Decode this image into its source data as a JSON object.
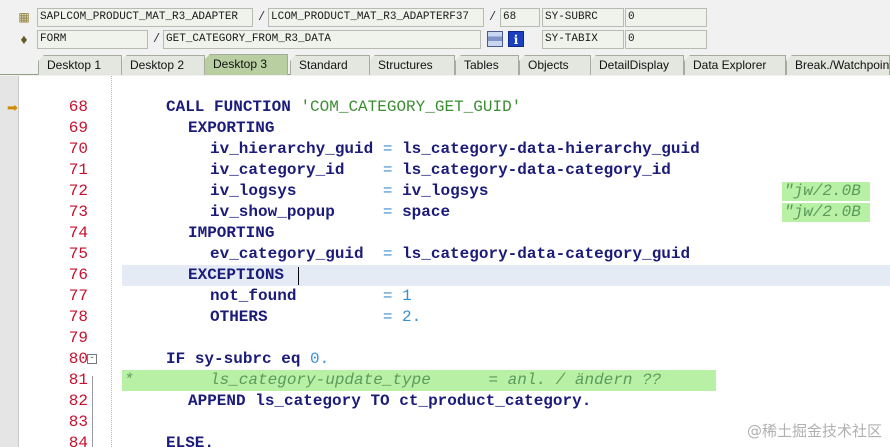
{
  "header": {
    "row1": {
      "program": "SAPLCOM_PRODUCT_MAT_R3_ADAPTER",
      "include": "LCOM_PRODUCT_MAT_R3_ADAPTERF37",
      "line": "68",
      "sysfield_name": "SY-SUBRC",
      "sysfield_value": "0"
    },
    "row2": {
      "event_type": "FORM",
      "event_name": "GET_CATEGORY_FROM_R3_DATA",
      "sysfield_name": "SY-TABIX",
      "sysfield_value": "0",
      "info_icon": "i"
    },
    "separator": "/"
  },
  "tabs": [
    {
      "label": "Desktop 1"
    },
    {
      "label": "Desktop 2"
    },
    {
      "label": "Desktop 3"
    },
    {
      "label": "Standard"
    },
    {
      "label": "Structures"
    },
    {
      "label": "Tables"
    },
    {
      "label": "Objects"
    },
    {
      "label": "DetailDisplay"
    },
    {
      "label": "Data Explorer"
    },
    {
      "label": "Break./Watchpoints"
    }
  ],
  "active_tab": "Desktop 3",
  "code": {
    "current_line": "68",
    "lines": [
      {
        "num": "68",
        "kw": "CALL FUNCTION",
        "str": "'COM_CATEGORY_GET_GUID'"
      },
      {
        "num": "69",
        "kw": "EXPORTING"
      },
      {
        "num": "70",
        "param": "iv_hierarchy_guid",
        "op": "=",
        "val": "ls_category-data-hierarchy_guid"
      },
      {
        "num": "71",
        "param": "iv_category_id",
        "op": "=",
        "val": "ls_category-data-category_id"
      },
      {
        "num": "72",
        "param": "iv_logsys",
        "op": "=",
        "val": "iv_logsys",
        "comment": "\"jw/2.0B"
      },
      {
        "num": "73",
        "param": "iv_show_popup",
        "op": "=",
        "val": "space",
        "comment": "\"jw/2.0B"
      },
      {
        "num": "74",
        "kw": "IMPORTING"
      },
      {
        "num": "75",
        "param": "ev_category_guid",
        "op": "=",
        "val": "ls_category-data-category_guid"
      },
      {
        "num": "76",
        "kw": "EXCEPTIONS"
      },
      {
        "num": "77",
        "param": "not_found",
        "op": "=",
        "val": "1"
      },
      {
        "num": "78",
        "param": "OTHERS",
        "op": "=",
        "val": "2."
      },
      {
        "num": "79"
      },
      {
        "num": "80",
        "kw": "IF",
        "rest": "sy-subrc",
        "kw2": "eq",
        "val": "0."
      },
      {
        "num": "81",
        "comment_star": "*",
        "comment": "ls_category-update_type      = anl. / ändern ??"
      },
      {
        "num": "82",
        "kw": "APPEND",
        "rest": "ls_category",
        "kw2": "TO",
        "val": "ct_product_category."
      },
      {
        "num": "83"
      },
      {
        "num": "84",
        "kw": "ELSE."
      }
    ]
  },
  "watermark": "@稀土掘金技术社区"
}
